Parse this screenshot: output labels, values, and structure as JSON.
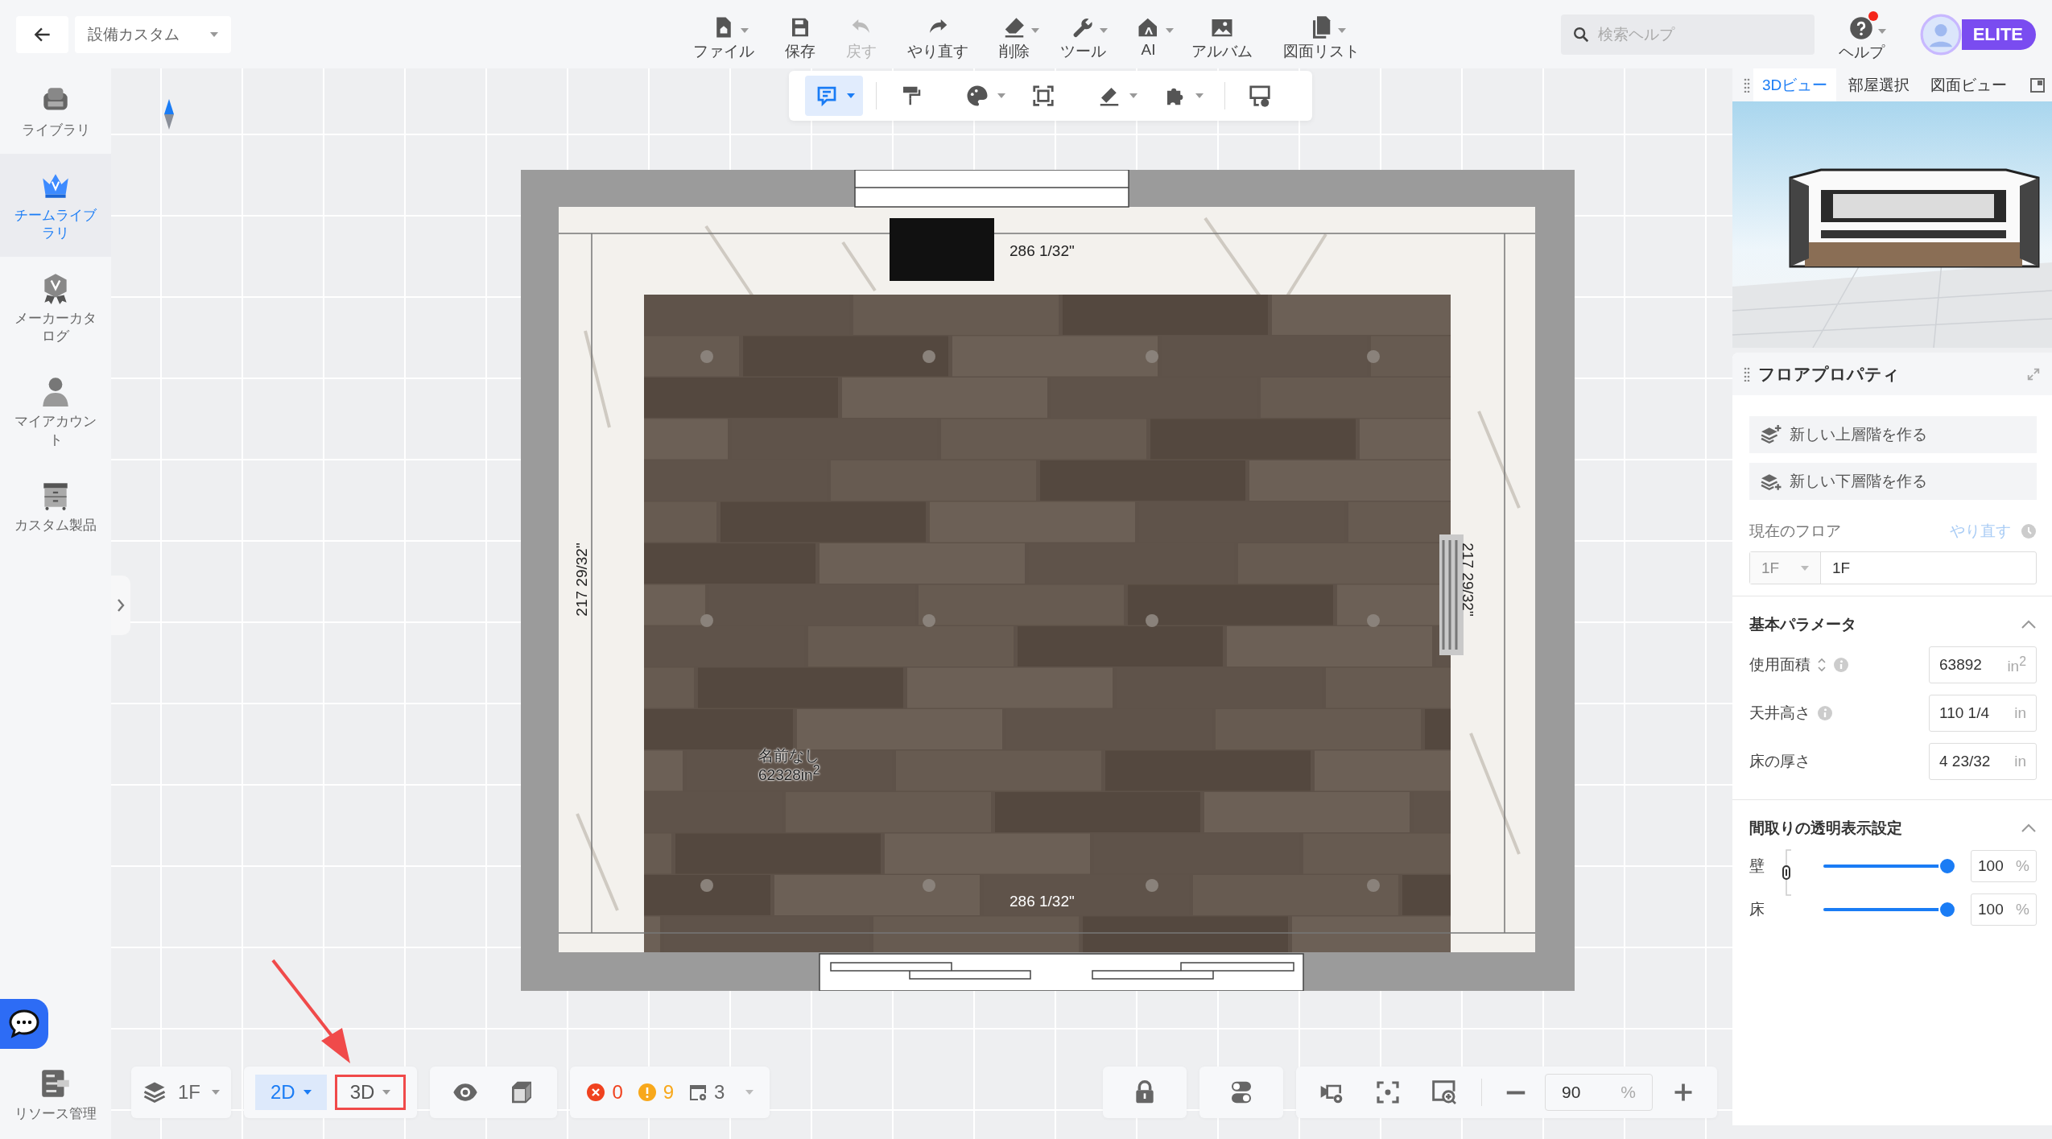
{
  "top_bar": {
    "title": "設備カスタム",
    "toolbar": [
      {
        "label": "ファイル",
        "dropdown": true,
        "disabled": false
      },
      {
        "label": "保存",
        "dropdown": false,
        "disabled": false
      },
      {
        "label": "戻す",
        "dropdown": false,
        "disabled": true
      },
      {
        "label": "やり直す",
        "dropdown": false,
        "disabled": false
      },
      {
        "label": "削除",
        "dropdown": true,
        "disabled": false
      },
      {
        "label": "ツール",
        "dropdown": true,
        "disabled": false
      },
      {
        "label": "AI",
        "dropdown": true,
        "disabled": false
      },
      {
        "label": "アルバム",
        "dropdown": false,
        "disabled": false
      },
      {
        "label": "図面リスト",
        "dropdown": true,
        "disabled": false
      }
    ]
  },
  "search": {
    "placeholder": "検索ヘルプ"
  },
  "help": {
    "label": "ヘルプ",
    "notification": true,
    "dropdown": true
  },
  "account": {
    "badge": "ELITE"
  },
  "sidebar": {
    "items": [
      {
        "label": "ライブラリ",
        "selected": false
      },
      {
        "label": "チームライブラリ",
        "selected": true
      },
      {
        "label": "メーカーカタログ",
        "selected": false
      },
      {
        "label": "マイアカウント",
        "selected": false
      },
      {
        "label": "カスタム製品",
        "selected": false
      }
    ],
    "footer_item": "リソース管理"
  },
  "canvas_toolbar": [
    {
      "selected": true,
      "dropdown": true
    },
    {
      "selected": false,
      "dropdown": false
    },
    {
      "selected": false,
      "dropdown": true
    },
    {
      "selected": false,
      "dropdown": false
    },
    {
      "selected": false,
      "dropdown": true
    },
    {
      "selected": false,
      "dropdown": true
    },
    {
      "selected": false,
      "dropdown": false
    }
  ],
  "plan": {
    "dimension_top": "286 1/32\"",
    "dimension_left": "217 29/32\"",
    "dimension_right": "217 29/32\"",
    "dimension_bottom": "286 1/32\"",
    "room": {
      "name": "名前なし",
      "area": "62328in$^{2}$"
    }
  },
  "view_panel": {
    "tabs": [
      {
        "label": "3Dビュー",
        "selected": true
      },
      {
        "label": "部屋選択",
        "selected": false
      },
      {
        "label": "図面ビュー",
        "selected": false
      }
    ]
  },
  "floor_properties": {
    "title": "フロアプロパティ",
    "actions": [
      "新しい上層階を作る",
      "新しい下層階を作る"
    ],
    "current_floor": {
      "label": "現在のフロア",
      "link": "やり直す",
      "select": "1F",
      "value": "1F"
    },
    "basic": {
      "title": "基本パラメータ",
      "expanded": true,
      "fields": [
        {
          "label": "使用面積",
          "value": "63892",
          "unit": "in$^{2}$",
          "kind": "sortable"
        },
        {
          "label": "天井高さ",
          "value": "110 1/4",
          "unit": "in",
          "kind": "info"
        },
        {
          "label": "床の厚さ",
          "value": "4 23/32",
          "unit": "in",
          "kind": "plain"
        }
      ]
    },
    "transparency": {
      "title": "間取りの透明表示設定",
      "expanded": true,
      "linked": true,
      "sliders": [
        {
          "label": "壁",
          "level": 1,
          "value": "100",
          "unit": "%"
        },
        {
          "label": "床",
          "level": 1,
          "value": "100",
          "unit": "%"
        }
      ]
    }
  },
  "bottom_bar": {
    "floor": "1F",
    "view_modes": [
      {
        "label": "2D",
        "selected": true,
        "highlighted": false
      },
      {
        "label": "3D",
        "selected": false,
        "highlighted": true
      }
    ],
    "errors": "0",
    "warnings": "9",
    "items": "3",
    "zoom": {
      "value": "90",
      "unit": "%"
    }
  }
}
